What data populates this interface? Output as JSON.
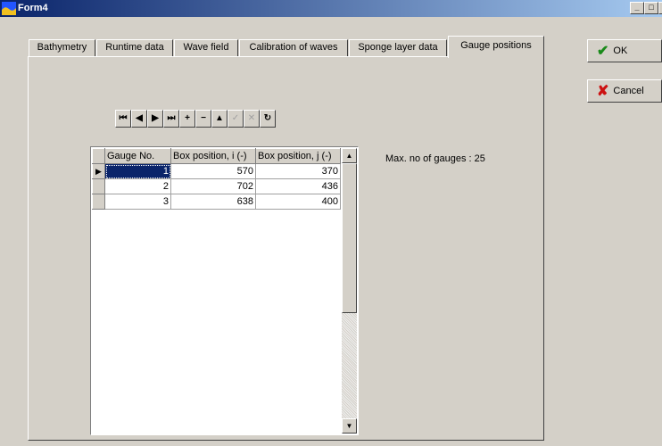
{
  "window": {
    "title": "Form4",
    "controls": [
      "_",
      "□",
      "✕"
    ]
  },
  "tabs": [
    {
      "label": "Bathymetry",
      "active": false
    },
    {
      "label": "Runtime data",
      "active": false
    },
    {
      "label": "Wave field",
      "active": false
    },
    {
      "label": "Calibration of waves",
      "active": false
    },
    {
      "label": "Sponge layer data",
      "active": false
    },
    {
      "label": "Gauge positions",
      "active": true
    }
  ],
  "navigator": {
    "buttons": [
      {
        "name": "first-record-icon",
        "glyph": "⏮",
        "enabled": true
      },
      {
        "name": "prior-record-icon",
        "glyph": "◀",
        "enabled": true
      },
      {
        "name": "next-record-icon",
        "glyph": "▶",
        "enabled": true
      },
      {
        "name": "last-record-icon",
        "glyph": "⏭",
        "enabled": true
      },
      {
        "name": "insert-record-icon",
        "glyph": "+",
        "enabled": true
      },
      {
        "name": "delete-record-icon",
        "glyph": "−",
        "enabled": true
      },
      {
        "name": "edit-record-icon",
        "glyph": "▲",
        "enabled": true
      },
      {
        "name": "post-edit-icon",
        "glyph": "✓",
        "enabled": false
      },
      {
        "name": "cancel-edit-icon",
        "glyph": "✕",
        "enabled": false
      },
      {
        "name": "refresh-data-icon",
        "glyph": "↻",
        "enabled": true
      }
    ]
  },
  "grid": {
    "columns": [
      "Gauge No.",
      "Box position, i (-)",
      "Box position, j (-)"
    ],
    "rows": [
      [
        "1",
        "570",
        "370"
      ],
      [
        "2",
        "702",
        "436"
      ],
      [
        "3",
        "638",
        "400"
      ]
    ]
  },
  "info": {
    "max_label": "Max. no of gauges : 25"
  },
  "buttons": {
    "ok": "OK",
    "cancel": "Cancel"
  },
  "colors": {
    "title_start": "#0a246a",
    "title_end": "#a6caf0",
    "face": "#d4d0c8",
    "selection": "#0a246a"
  }
}
